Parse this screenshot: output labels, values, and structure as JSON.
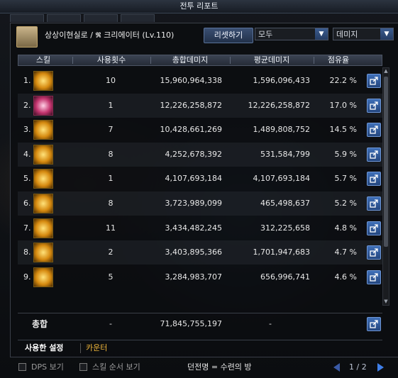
{
  "window": {
    "title": "전투 리포트"
  },
  "header": {
    "character": "상상이현실로 / 𝕽 크리에이터 (Lv.110)",
    "reset_label": "리셋하기",
    "filter_value": "모두",
    "metric_value": "데미지"
  },
  "table": {
    "columns": [
      "스킬",
      "사용횟수",
      "총합데미지",
      "평균데미지",
      "점유율"
    ],
    "rows": [
      {
        "rank": "1.",
        "icon": "skill-icon-1",
        "count": "10",
        "total": "15,960,964,338",
        "avg": "1,596,096,433",
        "share": "22.2  %"
      },
      {
        "rank": "2.",
        "icon": "skill-icon-2",
        "count": "1",
        "total": "12,226,258,872",
        "avg": "12,226,258,872",
        "share": "17.0  %"
      },
      {
        "rank": "3.",
        "icon": "skill-icon-3",
        "count": "7",
        "total": "10,428,661,269",
        "avg": "1,489,808,752",
        "share": "14.5  %"
      },
      {
        "rank": "4.",
        "icon": "skill-icon-4",
        "count": "8",
        "total": "4,252,678,392",
        "avg": "531,584,799",
        "share": "5.9  %"
      },
      {
        "rank": "5.",
        "icon": "skill-icon-5",
        "count": "1",
        "total": "4,107,693,184",
        "avg": "4,107,693,184",
        "share": "5.7  %"
      },
      {
        "rank": "6.",
        "icon": "skill-icon-6",
        "count": "8",
        "total": "3,723,989,099",
        "avg": "465,498,637",
        "share": "5.2  %"
      },
      {
        "rank": "7.",
        "icon": "skill-icon-7",
        "count": "11",
        "total": "3,434,482,245",
        "avg": "312,225,658",
        "share": "4.8  %"
      },
      {
        "rank": "8.",
        "icon": "skill-icon-8",
        "count": "2",
        "total": "3,403,895,366",
        "avg": "1,701,947,683",
        "share": "4.7  %"
      },
      {
        "rank": "9.",
        "icon": "skill-icon-9",
        "count": "5",
        "total": "3,284,983,707",
        "avg": "656,996,741",
        "share": "4.6  %"
      }
    ]
  },
  "summary": {
    "label": "총합",
    "count": "-",
    "total": "71,845,755,197",
    "avg": "-"
  },
  "tabs": {
    "used": "사용한 설정",
    "counter": "카운터"
  },
  "footer": {
    "dps_label": "DPS 보기",
    "order_label": "스킬 순서 보기",
    "dungeon": "던전명 = 수련의 방",
    "page": "1 / 2"
  },
  "icons": {
    "share": "share-icon",
    "arrow": "chevron-down-icon"
  },
  "colors": {
    "accent": "#3f6fb8",
    "counter_tab": "#f0b73a"
  }
}
